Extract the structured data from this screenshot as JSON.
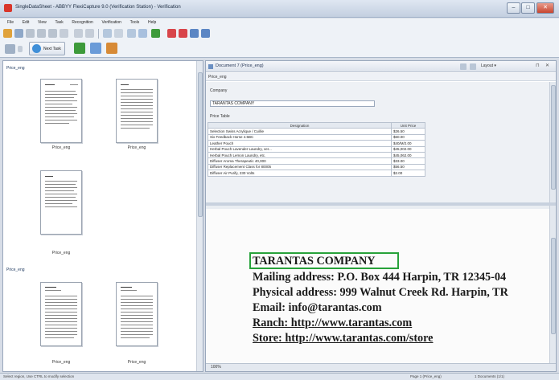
{
  "window": {
    "title": "SingleDataSheet - ABBYY FlexiCapture 9.0 (Verification Station) - Verification"
  },
  "menu": [
    "File",
    "Edit",
    "View",
    "Task",
    "Recognition",
    "Verification",
    "Tools",
    "Help"
  ],
  "toolbar": {
    "next_task_label": "Next Task"
  },
  "left_pane": {
    "groups": [
      {
        "header": "Price_eng",
        "thumbs": [
          {
            "label": "Price_eng"
          },
          {
            "label": "Price_eng"
          },
          {
            "label": "Price_eng"
          }
        ]
      },
      {
        "header": "Price_eng",
        "thumbs": [
          {
            "label": "Price_eng"
          },
          {
            "label": "Price_eng"
          }
        ]
      }
    ]
  },
  "document": {
    "tab_title": "Document 7 (Price_eng)",
    "section": "Price_eng",
    "layout_label": "Layout ▾",
    "company_label": "Company",
    "company_value": "TARANTAS COMPANY",
    "price_table_label": "Price Table",
    "table": {
      "headers": [
        "Designation",
        "Unit Price"
      ],
      "rows": [
        [
          "Selection Swiss Acrylique / Cuillie",
          "$26.50"
        ],
        [
          "Six Feedback Horse 4.5BC",
          "$60.00"
        ],
        [
          "Leather Pouch",
          "$40/M/2.00"
        ],
        [
          "Herbal Pouch Lavender Laundry, ver...",
          "$45,002.00"
        ],
        [
          "Herbal Pouch Lemon Laundry, etc.",
          "$45,062.00"
        ],
        [
          "Diffuser Aroma Therapeutic 40,000",
          "$33.00"
        ],
        [
          "Diffuser Replacement Class for 80005",
          "$56.50"
        ],
        [
          "Diffuser Air Purify, 230 Volts",
          "$2.00"
        ]
      ]
    }
  },
  "scan": {
    "lines": [
      "TARANTAS COMPANY",
      "Mailing address: P.O. Box 444 Harpin, TR 12345-04",
      "Physical address: 999 Walnut Creek Rd. Harpin, TR",
      "Email: info@tarantas.com",
      "Ranch:  http://www.tarantas.com",
      "Store:  http://www.tarantas.com/store"
    ],
    "zoom_label": "100%",
    "highlight_color": "#27a23a"
  },
  "status": {
    "left": "Select region, Use CTRL to modify selection",
    "page_info": "Page 1 (Price_eng)",
    "doc_info": "1 Documents (1/1)"
  }
}
